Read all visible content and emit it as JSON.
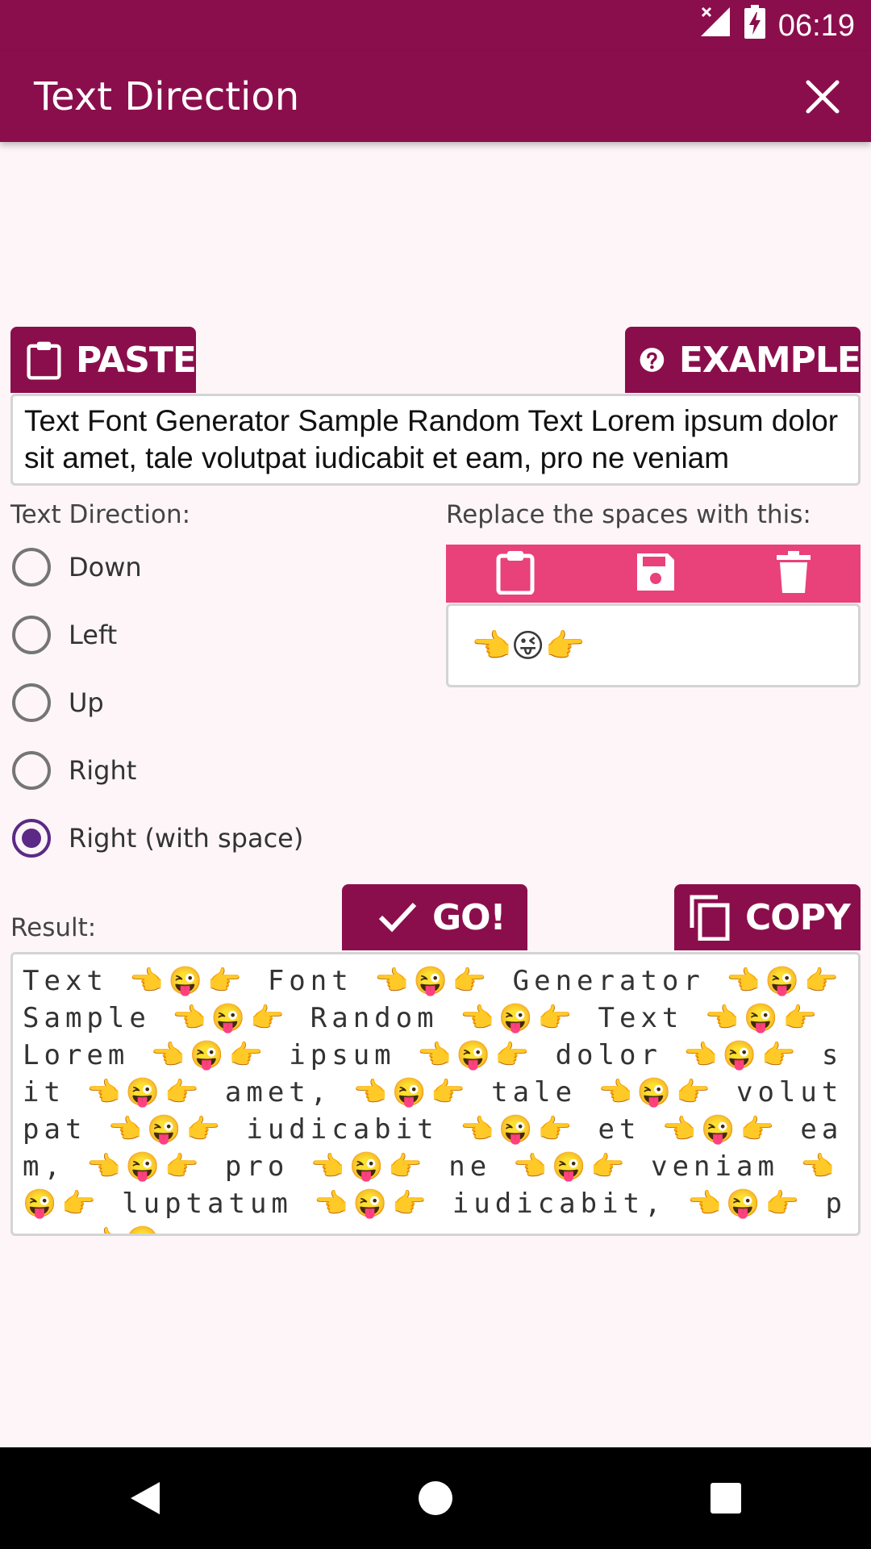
{
  "status_bar": {
    "time": "06:19"
  },
  "app_bar": {
    "title": "Text Direction"
  },
  "buttons": {
    "paste": "PASTE",
    "example": "EXAMPLE",
    "go": "GO!",
    "copy": "COPY"
  },
  "input": {
    "value": "Text Font Generator Sample Random Text Lorem ipsum dolor sit amet, tale volutpat iudicabit et eam, pro ne veniam"
  },
  "direction": {
    "label": "Text Direction:",
    "options": [
      "Down",
      "Left",
      "Up",
      "Right",
      "Right (with space)"
    ],
    "selected": "Right (with space)"
  },
  "replace": {
    "label": "Replace the spaces with this:",
    "value": "👈😜👉"
  },
  "result": {
    "label": "Result:",
    "value": "Text 👈😜👉 Font 👈😜👉 Generator 👈😜👉 Sample 👈😜👉 Random 👈😜👉 Text 👈😜👉 Lorem 👈😜👉 ipsum 👈😜👉 dolor 👈😜👉 sit 👈😜👉 amet, 👈😜👉 tale 👈😜👉 volutpat 👈😜👉 iudicabit 👈😜👉 et 👈😜👉 eam, 👈😜👉 pro 👈😜👉 ne 👈😜👉 veniam 👈😜👉 luptatum 👈😜👉 iudicabit, 👈😜👉 pro 👈😜"
  },
  "colors": {
    "primary": "#8b0e4c",
    "accent": "#e94179",
    "radio_selected": "#5b2a86",
    "background": "#fdf5f8"
  },
  "icons": [
    "no-signal-icon",
    "battery-charging-icon",
    "close-icon",
    "clipboard-icon",
    "help-circle-icon",
    "save-icon",
    "trash-icon",
    "check-icon",
    "copy-icon",
    "back-icon",
    "home-icon",
    "recents-icon"
  ]
}
